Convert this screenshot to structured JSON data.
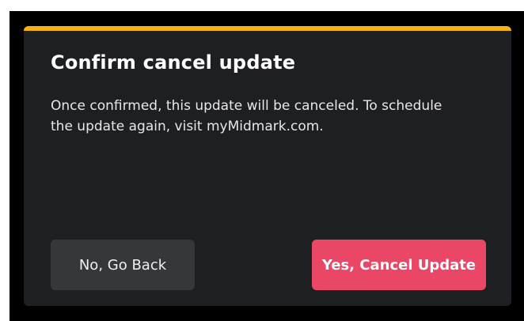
{
  "dialog": {
    "title": "Confirm cancel update",
    "message_line1": "Once confirmed, this update will be canceled. To schedule",
    "message_line2": "the update again, visit myMidmark.com.",
    "secondary_button_label": "No, Go Back",
    "primary_button_label": "Yes, Cancel Update"
  },
  "colors": {
    "accent": "#f6b40e",
    "dialog_background": "#1e1f22",
    "secondary_button": "#35373b",
    "primary_button": "#e94765"
  }
}
